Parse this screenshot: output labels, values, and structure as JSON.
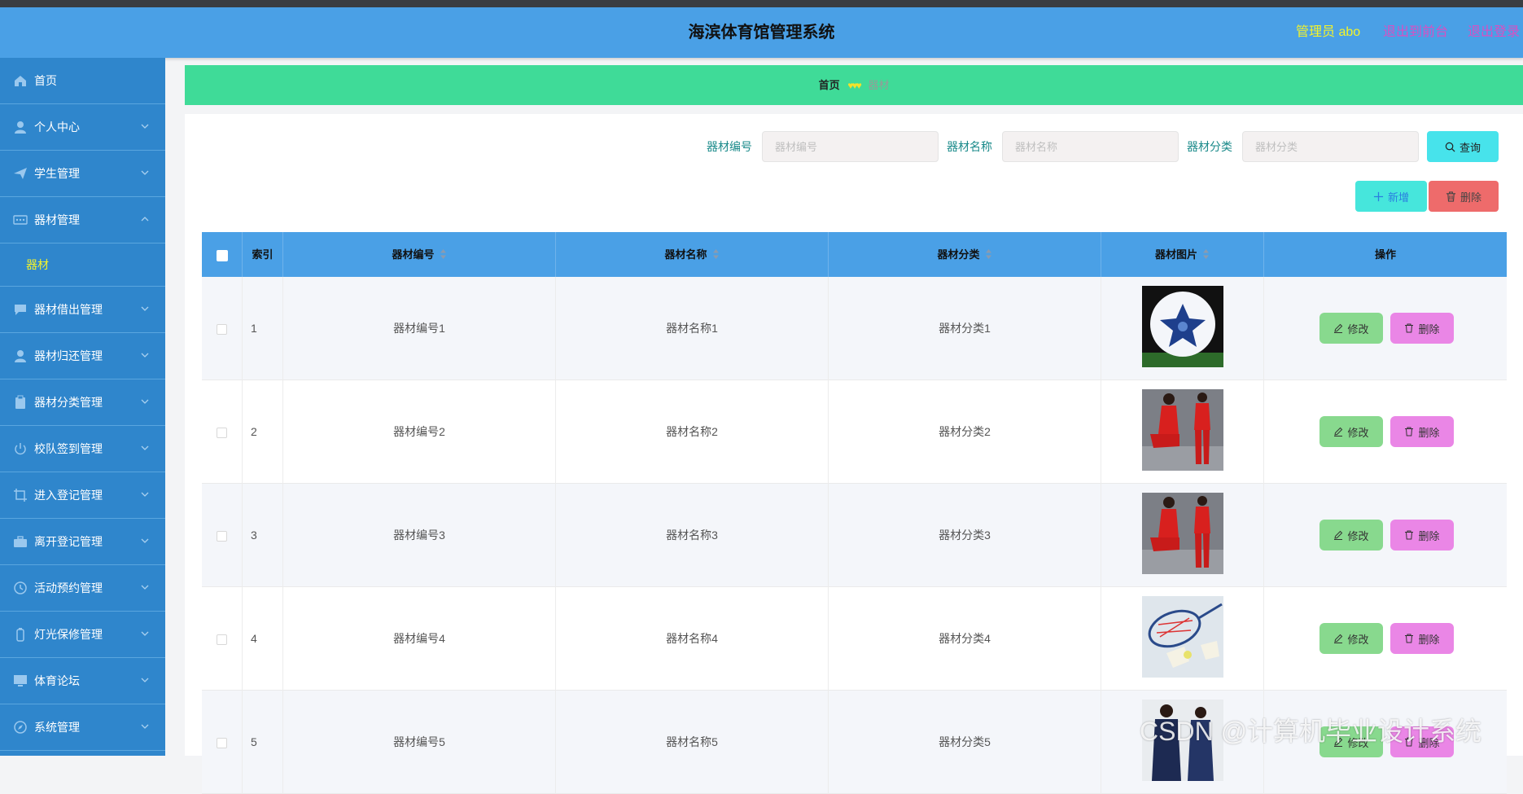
{
  "header": {
    "title": "海滨体育馆管理系统",
    "admin": "管理员 abo",
    "to_front": "退出到前台",
    "logout": "退出登录"
  },
  "sidebar": {
    "items": [
      {
        "label": "首页",
        "icon": "home-icon"
      },
      {
        "label": "个人中心",
        "icon": "user-icon"
      },
      {
        "label": "学生管理",
        "icon": "send-icon"
      },
      {
        "label": "器材管理",
        "icon": "chat-dots-icon",
        "sub": "器材"
      },
      {
        "label": "器材借出管理",
        "icon": "message-icon"
      },
      {
        "label": "器材归还管理",
        "icon": "user-icon"
      },
      {
        "label": "器材分类管理",
        "icon": "clipboard-icon"
      },
      {
        "label": "校队签到管理",
        "icon": "power-icon"
      },
      {
        "label": "进入登记管理",
        "icon": "crop-icon"
      },
      {
        "label": "离开登记管理",
        "icon": "suitcase-icon"
      },
      {
        "label": "活动预约管理",
        "icon": "clock-icon"
      },
      {
        "label": "灯光保修管理",
        "icon": "battery-icon"
      },
      {
        "label": "体育论坛",
        "icon": "monitor-icon"
      },
      {
        "label": "系统管理",
        "icon": "compass-icon"
      }
    ]
  },
  "breadcrumb": {
    "home": "首页",
    "separator": "♥♥♥",
    "current": "器材"
  },
  "search": {
    "field1_label": "器材编号",
    "field1_placeholder": "器材编号",
    "field2_label": "器材名称",
    "field2_placeholder": "器材名称",
    "field3_label": "器材分类",
    "field3_placeholder": "器材分类",
    "query_label": "查询",
    "add_label": "新增",
    "delete_label": "删除"
  },
  "table": {
    "headers": {
      "index": "索引",
      "code": "器材编号",
      "name": "器材名称",
      "category": "器材分类",
      "image": "器材图片",
      "actions": "操作"
    },
    "edit_label": "修改",
    "delete_label": "删除",
    "rows": [
      {
        "index": "1",
        "code": "器材编号1",
        "name": "器材名称1",
        "category": "器材分类1",
        "image": "soccer-ball"
      },
      {
        "index": "2",
        "code": "器材编号2",
        "name": "器材名称2",
        "category": "器材分类2",
        "image": "red-tracksuit"
      },
      {
        "index": "3",
        "code": "器材编号3",
        "name": "器材名称3",
        "category": "器材分类3",
        "image": "red-tracksuit"
      },
      {
        "index": "4",
        "code": "器材编号4",
        "name": "器材名称4",
        "category": "器材分类4",
        "image": "badminton"
      },
      {
        "index": "5",
        "code": "器材编号5",
        "name": "器材名称5",
        "category": "器材分类5",
        "image": "navy-tracksuit"
      }
    ]
  },
  "watermark": "CSDN @计算机毕业设计系统"
}
